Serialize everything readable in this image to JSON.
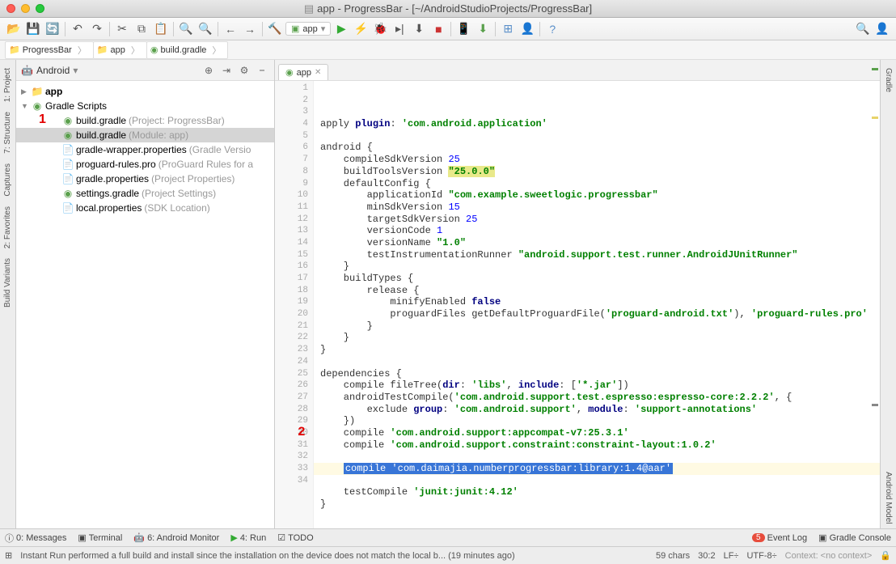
{
  "title": "app - ProgressBar - [~/AndroidStudioProjects/ProgressBar]",
  "breadcrumb": [
    {
      "icon": "folder",
      "label": "ProgressBar"
    },
    {
      "icon": "folder",
      "label": "app"
    },
    {
      "icon": "gradle",
      "label": "build.gradle"
    }
  ],
  "runConfig": "app",
  "projectView": "Android",
  "tree": {
    "root": "app",
    "gradleScripts": "Gradle Scripts",
    "items": [
      {
        "name": "build.gradle",
        "hint": "(Project: ProgressBar)"
      },
      {
        "name": "build.gradle",
        "hint": "(Module: app)",
        "selected": true
      },
      {
        "name": "gradle-wrapper.properties",
        "hint": "(Gradle Versio"
      },
      {
        "name": "proguard-rules.pro",
        "hint": "(ProGuard Rules for a"
      },
      {
        "name": "gradle.properties",
        "hint": "(Project Properties)"
      },
      {
        "name": "settings.gradle",
        "hint": "(Project Settings)"
      },
      {
        "name": "local.properties",
        "hint": "(SDK Location)"
      }
    ]
  },
  "annotations": {
    "a1": "1",
    "a2": "2"
  },
  "editorTab": "app",
  "code": {
    "lines": [
      {
        "n": 1,
        "seg": [
          {
            "t": "apply "
          },
          {
            "t": "plugin",
            "c": "kw"
          },
          {
            "t": ": "
          },
          {
            "t": "'com.android.application'",
            "c": "str"
          }
        ]
      },
      {
        "n": 2,
        "seg": []
      },
      {
        "n": 3,
        "seg": [
          {
            "t": "android {"
          }
        ]
      },
      {
        "n": 4,
        "seg": [
          {
            "t": "    compileSdkVersion "
          },
          {
            "t": "25",
            "c": "num"
          }
        ]
      },
      {
        "n": 5,
        "seg": [
          {
            "t": "    buildToolsVersion "
          },
          {
            "t": "\"25.0.0\"",
            "c": "str hl-yellow"
          }
        ]
      },
      {
        "n": 6,
        "seg": [
          {
            "t": "    defaultConfig {"
          }
        ]
      },
      {
        "n": 7,
        "seg": [
          {
            "t": "        applicationId "
          },
          {
            "t": "\"com.example.sweetlogic.progressbar\"",
            "c": "str"
          }
        ]
      },
      {
        "n": 8,
        "seg": [
          {
            "t": "        minSdkVersion "
          },
          {
            "t": "15",
            "c": "num"
          }
        ]
      },
      {
        "n": 9,
        "seg": [
          {
            "t": "        targetSdkVersion "
          },
          {
            "t": "25",
            "c": "num"
          }
        ]
      },
      {
        "n": 10,
        "seg": [
          {
            "t": "        versionCode "
          },
          {
            "t": "1",
            "c": "num"
          }
        ]
      },
      {
        "n": 11,
        "seg": [
          {
            "t": "        versionName "
          },
          {
            "t": "\"1.0\"",
            "c": "str"
          }
        ]
      },
      {
        "n": 12,
        "seg": [
          {
            "t": "        testInstrumentationRunner "
          },
          {
            "t": "\"android.support.test.runner.AndroidJUnitRunner\"",
            "c": "str"
          }
        ]
      },
      {
        "n": 13,
        "seg": [
          {
            "t": "    }"
          }
        ]
      },
      {
        "n": 14,
        "seg": [
          {
            "t": "    buildTypes {"
          }
        ]
      },
      {
        "n": 15,
        "seg": [
          {
            "t": "        release {"
          }
        ]
      },
      {
        "n": 16,
        "seg": [
          {
            "t": "            minifyEnabled "
          },
          {
            "t": "false",
            "c": "kw"
          }
        ]
      },
      {
        "n": 17,
        "seg": [
          {
            "t": "            proguardFiles getDefaultProguardFile("
          },
          {
            "t": "'proguard-android.txt'",
            "c": "str"
          },
          {
            "t": "), "
          },
          {
            "t": "'proguard-rules.pro'",
            "c": "str"
          }
        ]
      },
      {
        "n": 18,
        "seg": [
          {
            "t": "        }"
          }
        ]
      },
      {
        "n": 19,
        "seg": [
          {
            "t": "    }"
          }
        ]
      },
      {
        "n": 20,
        "seg": [
          {
            "t": "}"
          }
        ]
      },
      {
        "n": 21,
        "seg": []
      },
      {
        "n": 22,
        "seg": [
          {
            "t": "dependencies {"
          }
        ]
      },
      {
        "n": 23,
        "seg": [
          {
            "t": "    compile fileTree("
          },
          {
            "t": "dir",
            "c": "kw"
          },
          {
            "t": ": "
          },
          {
            "t": "'libs'",
            "c": "str"
          },
          {
            "t": ", "
          },
          {
            "t": "include",
            "c": "kw"
          },
          {
            "t": ": ["
          },
          {
            "t": "'*.jar'",
            "c": "str"
          },
          {
            "t": "])"
          }
        ]
      },
      {
        "n": 24,
        "seg": [
          {
            "t": "    androidTestCompile("
          },
          {
            "t": "'com.android.support.test.espresso:espresso-core:2.2.2'",
            "c": "str"
          },
          {
            "t": ", {"
          }
        ]
      },
      {
        "n": 25,
        "seg": [
          {
            "t": "        exclude "
          },
          {
            "t": "group",
            "c": "kw"
          },
          {
            "t": ": "
          },
          {
            "t": "'com.android.support'",
            "c": "str"
          },
          {
            "t": ", "
          },
          {
            "t": "module",
            "c": "kw"
          },
          {
            "t": ": "
          },
          {
            "t": "'support-annotations'",
            "c": "str"
          }
        ]
      },
      {
        "n": 26,
        "seg": [
          {
            "t": "    })"
          }
        ]
      },
      {
        "n": 27,
        "seg": [
          {
            "t": "    compile "
          },
          {
            "t": "'com.android.support:appcompat-v7:25.3.1'",
            "c": "str"
          }
        ]
      },
      {
        "n": 28,
        "seg": [
          {
            "t": "    compile "
          },
          {
            "t": "'com.android.support.constraint:constraint-layout:1.0.2'",
            "c": "str"
          }
        ]
      },
      {
        "n": 29,
        "seg": []
      },
      {
        "n": 30,
        "seg": [
          {
            "t": "    "
          },
          {
            "t": "compile 'com.daimajia.numberprogressbar:library:1.4@aar'",
            "c": "hl-sel"
          }
        ],
        "hl": true
      },
      {
        "n": 31,
        "seg": []
      },
      {
        "n": 32,
        "seg": [
          {
            "t": "    testCompile "
          },
          {
            "t": "'junit:junit:4.12'",
            "c": "str"
          }
        ]
      },
      {
        "n": 33,
        "seg": [
          {
            "t": "}"
          }
        ]
      },
      {
        "n": 34,
        "seg": []
      }
    ]
  },
  "bottomTabs": {
    "messages": "0: Messages",
    "terminal": "Terminal",
    "monitor": "6: Android Monitor",
    "run": "4: Run",
    "todo": "TODO",
    "eventLog": "Event Log",
    "eventCount": "5",
    "gradleConsole": "Gradle Console"
  },
  "leftTabs": {
    "project": "1: Project",
    "structure": "7: Structure",
    "captures": "Captures",
    "favorites": "2: Favorites",
    "buildVariants": "Build Variants"
  },
  "rightTabs": {
    "gradle": "Gradle",
    "androidModel": "Android Model"
  },
  "status": {
    "msg": "Instant Run performed a full build and install since the installation on the device does not match the local b... (19 minutes ago)",
    "chars": "59 chars",
    "pos": "30:2",
    "lf": "LF÷",
    "enc": "UTF-8÷",
    "context": "Context: <no context>"
  }
}
